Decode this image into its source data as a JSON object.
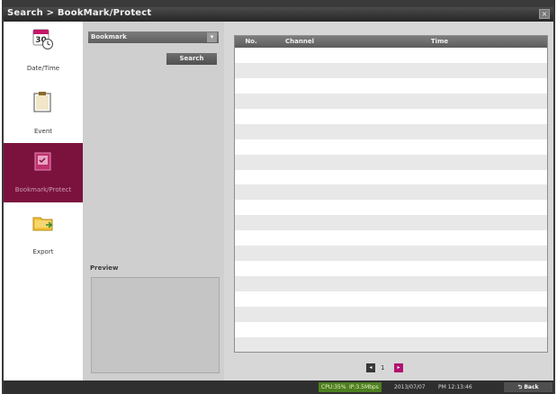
{
  "window": {
    "title": "Search > BookMark/Protect",
    "close_glyph": "×"
  },
  "nav": {
    "items": [
      {
        "label": "Date/Time",
        "icon": "calendar-clock-icon",
        "active": false
      },
      {
        "label": "Event",
        "icon": "clipboard-icon",
        "active": false
      },
      {
        "label": "Bookmark/Protect",
        "icon": "bookmark-icon",
        "active": true
      },
      {
        "label": "Export",
        "icon": "folder-export-icon",
        "active": false
      }
    ]
  },
  "filter": {
    "select_value": "Bookmark",
    "search_label": "Search",
    "preview_label": "Preview"
  },
  "table": {
    "columns": [
      "No.",
      "Channel",
      "Time"
    ],
    "rows": []
  },
  "pager": {
    "prev_glyph": "◂",
    "page": "1",
    "next_glyph": "▸"
  },
  "status": {
    "cpu": "CPU:35%",
    "net": "IP:3.5Mbps",
    "date": "2013/07/07",
    "time": "PM 12:13:46",
    "back_label": "Back"
  },
  "colors": {
    "active_nav": "#7b123e",
    "next_page": "#b1136f",
    "status_ok": "#4d7f1f"
  }
}
